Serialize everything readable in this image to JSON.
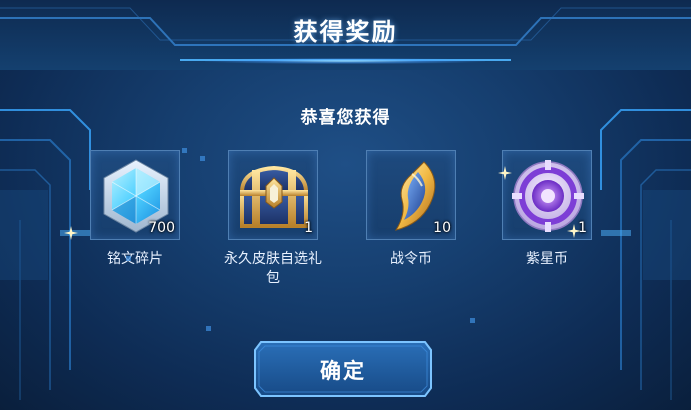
{
  "dialog": {
    "title": "获得奖励",
    "subtitle": "恭喜您获得",
    "confirm_label": "确定"
  },
  "rewards": [
    {
      "name": "铭文碎片",
      "quantity": "700",
      "icon": "inscription-shard-icon"
    },
    {
      "name": "永久皮肤自选礼包",
      "quantity": "1",
      "icon": "treasure-chest-icon"
    },
    {
      "name": "战令币",
      "quantity": "10",
      "icon": "battle-pass-coin-icon"
    },
    {
      "name": "紫星币",
      "quantity": "1",
      "icon": "purple-star-coin-icon"
    }
  ],
  "colors": {
    "background": "#163f70",
    "accent": "#4fb6ff",
    "gold": "#d9a640",
    "purple": "#8a4fd8"
  }
}
